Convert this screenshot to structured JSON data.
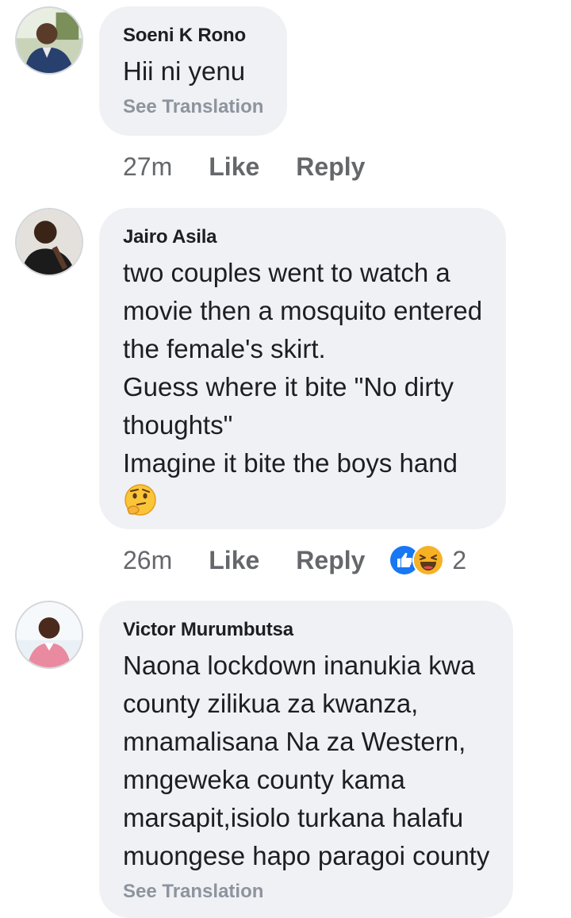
{
  "comments": [
    {
      "author": "Soeni K Rono",
      "lines": [
        "Hii ni yenu"
      ],
      "see_translation": "See Translation",
      "time": "27m",
      "like": "Like",
      "reply": "Reply"
    },
    {
      "author": "Jairo Asila",
      "lines": [
        "two couples went to watch a",
        "movie then a mosquito entered",
        "the female's skirt.",
        "Guess where it bite \"No dirty",
        "thoughts\"",
        "Imagine it bite the boys hand"
      ],
      "emoji": "thinking-face",
      "time": "26m",
      "like": "Like",
      "reply": "Reply",
      "reactions": [
        "like-icon",
        "haha-icon"
      ],
      "reaction_count": "2"
    },
    {
      "author": "Victor Murumbutsa",
      "lines": [
        "Naona lockdown inanukia kwa",
        "county zilikua za kwanza,",
        "mnamalisana Na za Western,",
        "mngeweka county kama",
        "marsapit,isiolo turkana halafu",
        "muongese hapo paragoi county"
      ],
      "see_translation": "See Translation"
    }
  ],
  "colors": {
    "bubble": "#f0f1f4",
    "meta_text": "#65676b",
    "translation_text": "#8d949e",
    "like_blue": "#1877f2",
    "haha_yellow": "#f7b125"
  }
}
